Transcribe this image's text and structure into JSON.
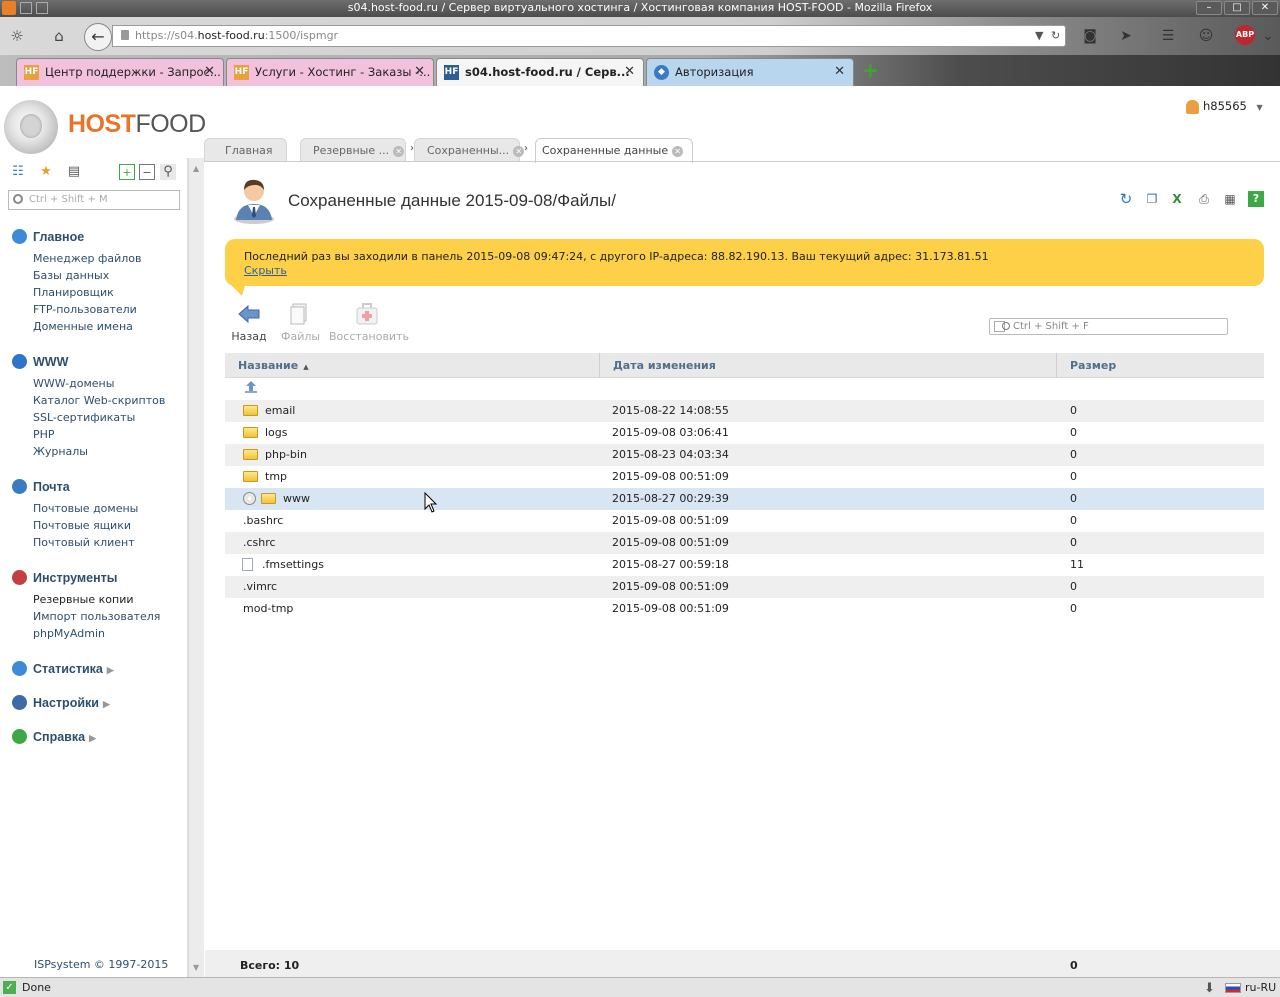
{
  "window": {
    "title": "s04.host-food.ru / Сервер виртуального хостинга / Хостинговая компания HOST-FOOD - Mozilla Firefox"
  },
  "browser": {
    "url_prefix": "https://s04.",
    "url_domain": "host-food.ru",
    "url_suffix": ":1500/ispmgr",
    "tabs": [
      {
        "label": "Центр поддержки - Запрос...",
        "favicon": "HF",
        "color": "#f2c2dd",
        "active": false
      },
      {
        "label": "Услуги - Хостинг - Заказы -...",
        "favicon": "HF",
        "color": "#f2c2dd",
        "active": false
      },
      {
        "label": "s04.host-food.ru / Серв...",
        "favicon": "HF",
        "color": "#f5f5f5",
        "active": true
      },
      {
        "label": "Авторизация",
        "favicon": "◆",
        "color": "#b8d6ee",
        "active": false
      }
    ],
    "new_tab": "+",
    "adblock": "ABP",
    "status": "Done",
    "locale": "ru-RU"
  },
  "app": {
    "logo_part1": "HOST",
    "logo_part2": "FOOD",
    "user": "h85565",
    "tabs": [
      {
        "label": "Главная"
      },
      {
        "label": "Резервные ..."
      },
      {
        "label": "Сохраненны..."
      },
      {
        "label": "Сохраненные данные"
      }
    ],
    "sidebar_search_placeholder": "Ctrl + Shift + M",
    "sidebar": {
      "sections": [
        {
          "title": "Главное",
          "icon_color": "#3d8ad9",
          "items": [
            "Менеджер файлов",
            "Базы данных",
            "Планировщик",
            "FTP-пользователи",
            "Доменные имена"
          ]
        },
        {
          "title": "WWW",
          "icon_color": "#2e74c7",
          "items": [
            "WWW-домены",
            "Каталог Web-скриптов",
            "SSL-сертификаты",
            "PHP",
            "Журналы"
          ]
        },
        {
          "title": "Почта",
          "icon_color": "#3a7cc2",
          "items": [
            "Почтовые домены",
            "Почтовые ящики",
            "Почтовый клиент"
          ]
        },
        {
          "title": "Инструменты",
          "icon_color": "#c44040",
          "items": [
            "Резервные копии",
            "Импорт пользователя",
            "phpMyAdmin"
          ]
        },
        {
          "title": "Статистика",
          "icon_color": "#3d8ad9",
          "items": []
        },
        {
          "title": "Настройки",
          "icon_color": "#3d6aa8",
          "items": []
        },
        {
          "title": "Справка",
          "icon_color": "#3da845",
          "items": []
        }
      ],
      "current_item": "Резервные копии"
    },
    "copyright": "ISPsystem © 1997-2015",
    "page_title": "Сохраненные данные  2015-09-08/Файлы/",
    "banner": {
      "text": "Последний раз вы заходили в панель 2015-09-08 09:47:24, с другого IP-адреса: 88.82.190.13. Ваш текущий адрес: 31.173.81.51",
      "hide": "Скрыть"
    },
    "actions": {
      "back": "Назад",
      "files": "Файлы",
      "restore": "Восстановить"
    },
    "table_search_placeholder": "Ctrl + Shift + F",
    "table": {
      "columns": [
        "Название",
        "Дата изменения",
        "Размер"
      ],
      "rows": [
        {
          "name": "",
          "date": "",
          "size": "",
          "icon": "up",
          "selected": false
        },
        {
          "name": "email",
          "date": "2015-08-22 14:08:55",
          "size": "0",
          "icon": "folder",
          "selected": false
        },
        {
          "name": "logs",
          "date": "2015-09-08 03:06:41",
          "size": "0",
          "icon": "folder",
          "selected": false
        },
        {
          "name": "php-bin",
          "date": "2015-08-23 04:03:34",
          "size": "0",
          "icon": "folder",
          "selected": false
        },
        {
          "name": "tmp",
          "date": "2015-09-08 00:51:09",
          "size": "0",
          "icon": "folder",
          "selected": false
        },
        {
          "name": "www",
          "date": "2015-08-27 00:29:39",
          "size": "0",
          "icon": "cd-folder",
          "selected": true
        },
        {
          "name": ".bashrc",
          "date": "2015-09-08 00:51:09",
          "size": "0",
          "icon": "none",
          "selected": false
        },
        {
          "name": ".cshrc",
          "date": "2015-09-08 00:51:09",
          "size": "0",
          "icon": "none",
          "selected": false
        },
        {
          "name": ".fmsettings",
          "date": "2015-08-27 00:59:18",
          "size": "11",
          "icon": "file",
          "selected": false
        },
        {
          "name": ".vimrc",
          "date": "2015-09-08 00:51:09",
          "size": "0",
          "icon": "none",
          "selected": false
        },
        {
          "name": "mod-tmp",
          "date": "2015-09-08 00:51:09",
          "size": "0",
          "icon": "none",
          "selected": false
        }
      ],
      "total": "Всего: 10",
      "total_size": "0"
    }
  }
}
